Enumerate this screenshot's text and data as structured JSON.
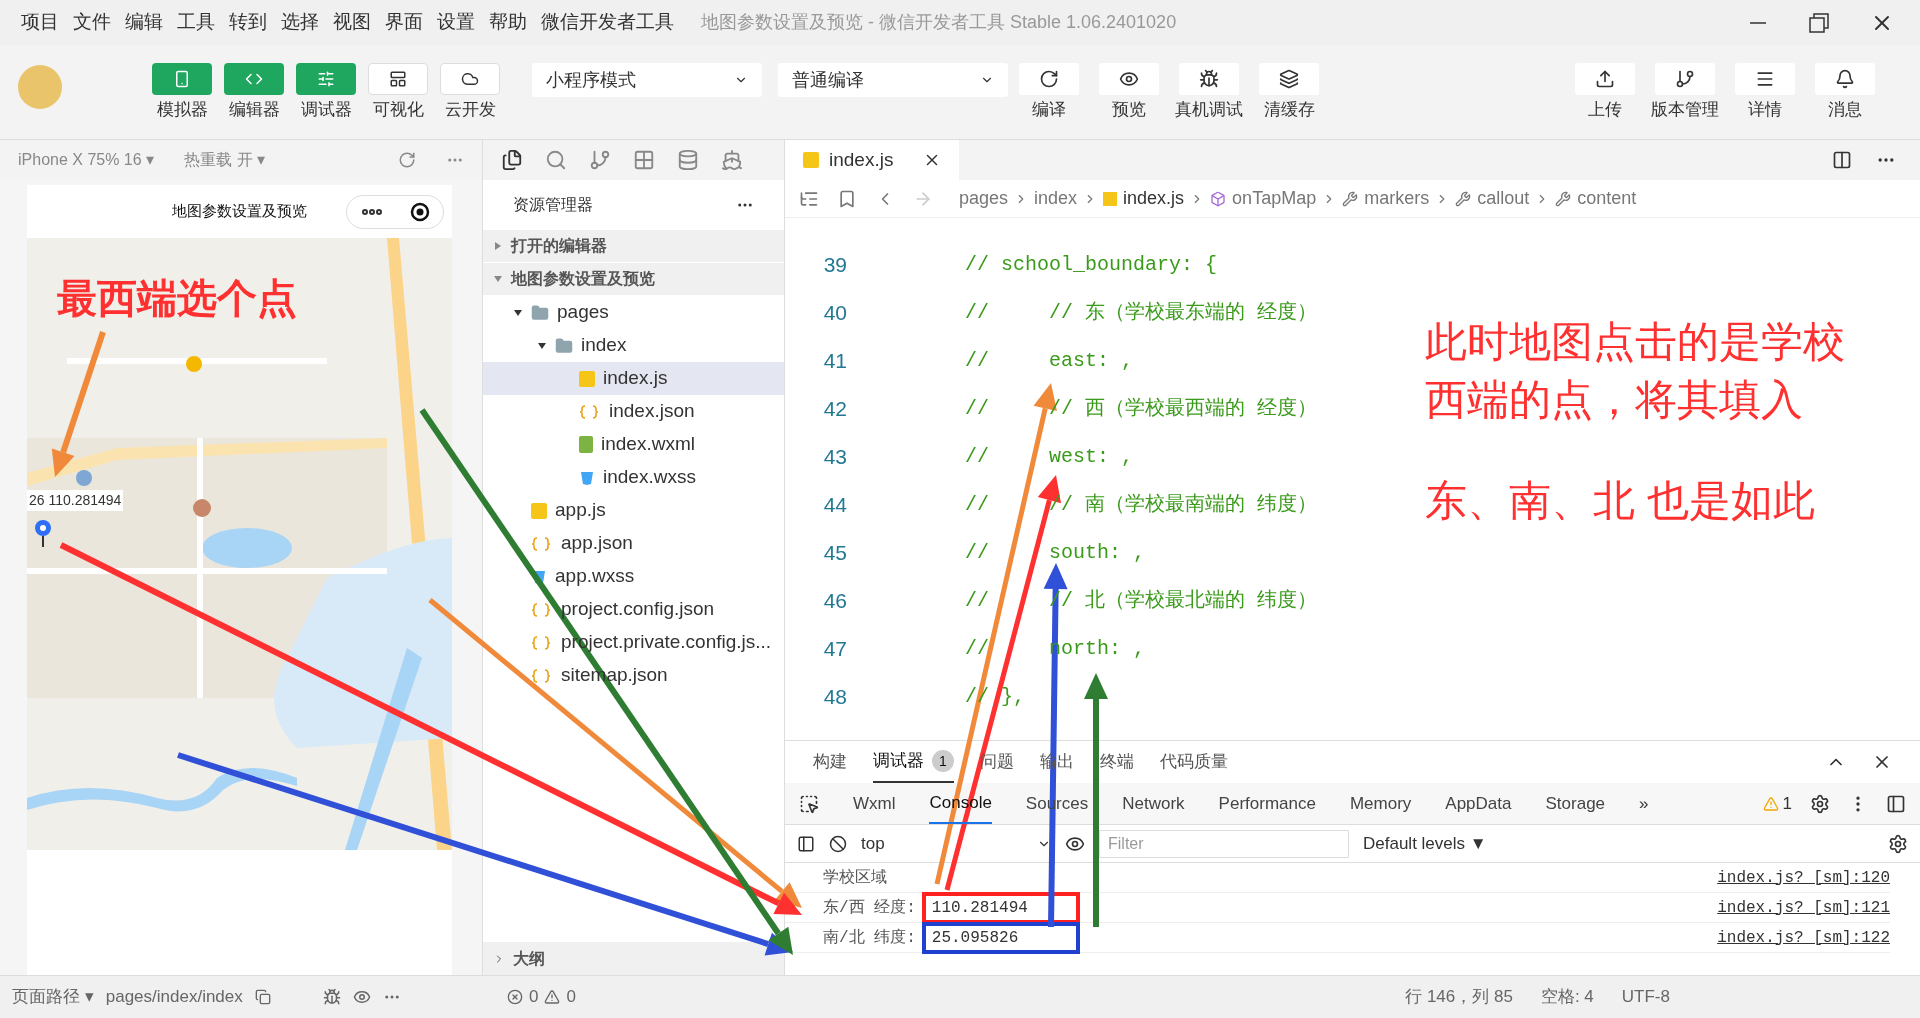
{
  "menu": [
    "项目",
    "文件",
    "编辑",
    "工具",
    "转到",
    "选择",
    "视图",
    "界面",
    "设置",
    "帮助",
    "微信开发者工具"
  ],
  "window": {
    "title": "地图参数设置及预览 - 微信开发者工具 Stable 1.06.2401020"
  },
  "toolbar": {
    "mode_buttons": [
      {
        "label": "模拟器",
        "active": true
      },
      {
        "label": "编辑器",
        "active": true
      },
      {
        "label": "调试器",
        "active": true
      },
      {
        "label": "可视化",
        "active": false
      },
      {
        "label": "云开发",
        "active": false
      }
    ],
    "mode_select": "小程序模式",
    "compile_select": "普通编译",
    "actions": [
      "编译",
      "预览",
      "真机调试",
      "清缓存"
    ],
    "right_actions": [
      "上传",
      "版本管理",
      "详情",
      "消息"
    ]
  },
  "simulator": {
    "device": "iPhone X 75% 16 ▾",
    "hot_reload": "热重载 开 ▾",
    "page_title": "地图参数设置及预览",
    "callout": "26 110.281494",
    "annotation": "最西端选个点"
  },
  "explorer": {
    "title": "资源管理器",
    "sections": [
      {
        "label": "打开的编辑器",
        "expanded": false
      },
      {
        "label": "地图参数设置及预览",
        "expanded": true,
        "children": [
          {
            "label": "pages",
            "kind": "folder",
            "expanded": true,
            "selected": false,
            "children": [
              {
                "label": "index",
                "kind": "folder",
                "expanded": true,
                "selected": false,
                "children": [
                  {
                    "label": "index.js",
                    "kind": "js",
                    "selected": true
                  },
                  {
                    "label": "index.json",
                    "kind": "json",
                    "selected": false
                  },
                  {
                    "label": "index.wxml",
                    "kind": "wxml",
                    "selected": false
                  },
                  {
                    "label": "index.wxss",
                    "kind": "wxss",
                    "selected": false
                  }
                ]
              }
            ]
          },
          {
            "label": "app.js",
            "kind": "js",
            "selected": false
          },
          {
            "label": "app.json",
            "kind": "json",
            "selected": false
          },
          {
            "label": "app.wxss",
            "kind": "wxss",
            "selected": false
          },
          {
            "label": "project.config.json",
            "kind": "json",
            "selected": false
          },
          {
            "label": "project.private.config.js...",
            "kind": "json",
            "selected": false
          },
          {
            "label": "sitemap.json",
            "kind": "json",
            "selected": false
          }
        ]
      }
    ],
    "outline": "大纲"
  },
  "editor": {
    "tab": "index.js",
    "breadcrumb": [
      "pages",
      "index",
      "index.js",
      "onTapMap",
      "markers",
      "callout",
      "content"
    ],
    "lines": [
      {
        "number": "39",
        "text": "// school_boundary: {"
      },
      {
        "number": "40",
        "text": "//     // 东（学校最东端的 经度）"
      },
      {
        "number": "41",
        "text": "//     east: ,"
      },
      {
        "number": "42",
        "text": "//     // 西（学校最西端的 经度）"
      },
      {
        "number": "43",
        "text": "//     west: ,"
      },
      {
        "number": "44",
        "text": "//     // 南（学校最南端的 纬度）"
      },
      {
        "number": "45",
        "text": "//     south: ,"
      },
      {
        "number": "46",
        "text": "//     // 北（学校最北端的 纬度）"
      },
      {
        "number": "47",
        "text": "//     north: ,"
      },
      {
        "number": "48",
        "text": "// },"
      }
    ],
    "annotation_lines": [
      "此时地图点击的是学校",
      "西端的点，将其填入"
    ],
    "annotation_note": "东、南、北 也是如此"
  },
  "devtools": {
    "panel_tabs": [
      {
        "label": "构建",
        "selected": false
      },
      {
        "label": "调试器",
        "selected": true,
        "badge": "1"
      },
      {
        "label": "问题",
        "selected": false
      },
      {
        "label": "输出",
        "selected": false
      },
      {
        "label": "终端",
        "selected": false
      },
      {
        "label": "代码质量",
        "selected": false
      }
    ],
    "tabs": [
      {
        "label": "Wxml",
        "selected": false
      },
      {
        "label": "Console",
        "selected": true
      },
      {
        "label": "Sources",
        "selected": false
      },
      {
        "label": "Network",
        "selected": false
      },
      {
        "label": "Performance",
        "selected": false
      },
      {
        "label": "Memory",
        "selected": false
      },
      {
        "label": "AppData",
        "selected": false
      },
      {
        "label": "Storage",
        "selected": false
      }
    ],
    "more": "»",
    "warnings": "1",
    "context": "top",
    "filter_placeholder": "Filter",
    "levels": "Default levels ▼",
    "console": [
      {
        "label": "学校区域",
        "source": "index.js? [sm]:120"
      },
      {
        "label": "东/西 经度:",
        "value": "110.281494",
        "color": "#ff2020",
        "source": "index.js? [sm]:121"
      },
      {
        "label": "南/北 纬度:",
        "value": "25.095826",
        "color": "#2040d0",
        "source": "index.js? [sm]:122"
      }
    ]
  },
  "status_bar": {
    "path_label": "页面路径 ▾",
    "path": "pages/index/index",
    "errors": "0",
    "warnings": "0",
    "position": "行 146，列 85",
    "indent": "空格: 4",
    "encoding": "UTF-8"
  }
}
